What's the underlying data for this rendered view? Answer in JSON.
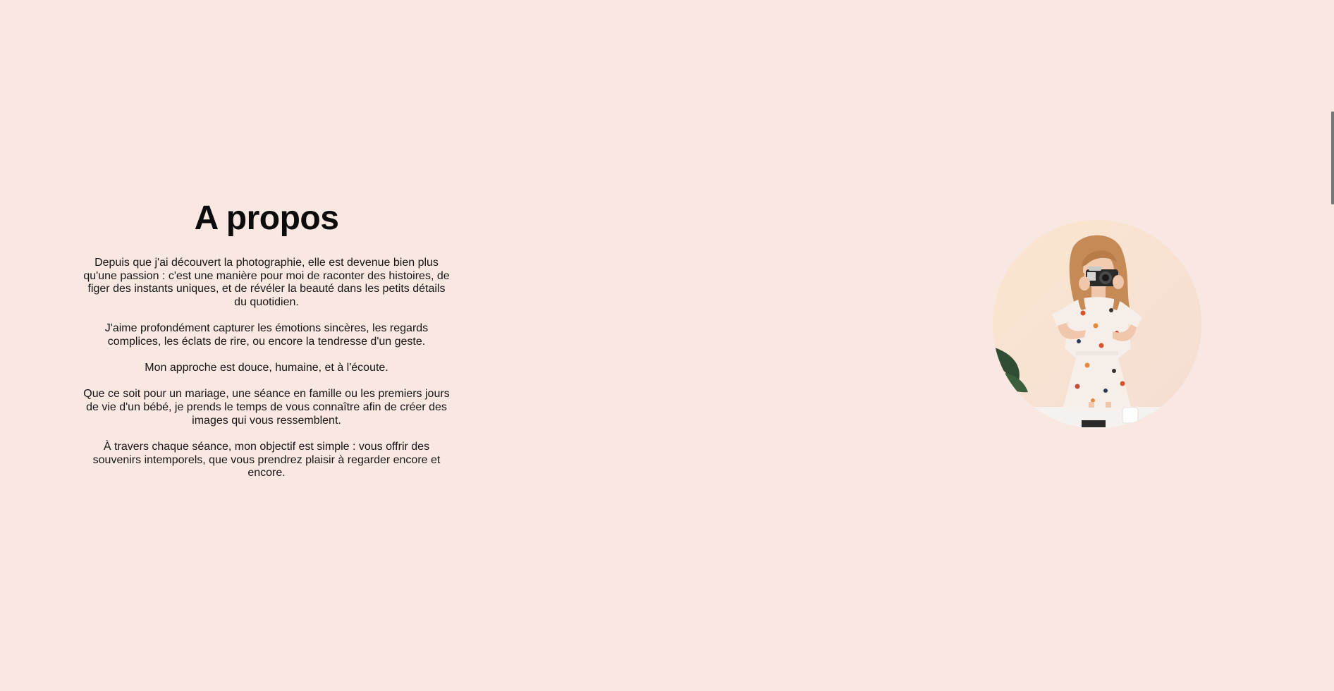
{
  "about": {
    "title": "A propos",
    "paragraphs": [
      "Depuis que j'ai découvert la photographie, elle est devenue bien plus qu'une passion : c'est une manière pour moi de raconter des histoires, de figer des instants uniques, et de révéler la beauté dans les petits détails du quotidien.",
      "J'aime profondément capturer les émotions sincères, les regards complices, les éclats de rire, ou encore la tendresse d'un geste.",
      "Mon approche est douce, humaine, et à l'écoute.",
      "Que ce soit pour un mariage, une séance en famille ou les premiers jours de vie d'un bébé, je prends le temps de vous connaître afin de créer des images qui vous ressemblent.",
      "À travers chaque séance, mon objectif est simple : vous offrir des souvenirs intemporels, que vous prendrez plaisir à regarder encore et encore."
    ]
  },
  "portrait": {
    "subject": "photographer-with-camera"
  },
  "colors": {
    "background": "#f9e7e1",
    "text": "#111111"
  }
}
